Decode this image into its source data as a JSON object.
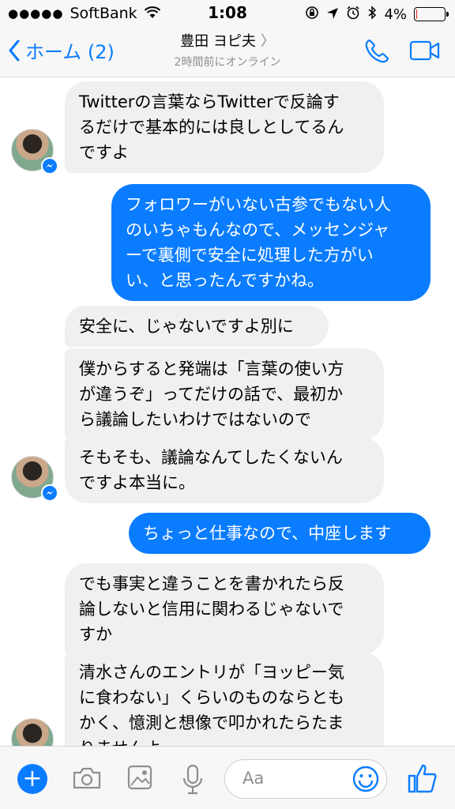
{
  "status_bar": {
    "signal": "●●●●●",
    "carrier": "SoftBank",
    "time": "1:08",
    "battery_percent_label": "4%",
    "battery_level": 0.04
  },
  "nav": {
    "back_label": "ホーム (2)",
    "title": "豊田 ヨピ夫",
    "subtitle": "2時間前にオンライン"
  },
  "messages": [
    {
      "direction": "in",
      "lines": [
        "Twitterの言葉ならTwitterで反論す",
        "るだけで基本的には良しとしてるん",
        "ですよ"
      ]
    },
    {
      "direction": "out",
      "lines": [
        "フォロワーがいない古参でもない人",
        "のいちゃもんなので、メッセンジャ",
        "ーで裏側で安全に処理した方がい",
        "い、と思ったんですかね。"
      ]
    },
    {
      "direction": "in",
      "lines": [
        "安全に、じゃないですよ別に"
      ]
    },
    {
      "direction": "in",
      "lines": [
        "僕からすると発端は「言葉の使い方",
        "が違うぞ」ってだけの話で、最初か",
        "ら議論したいわけではないので"
      ]
    },
    {
      "direction": "in",
      "lines": [
        "そもそも、議論なんてしたくないん",
        "ですよ本当に。"
      ]
    },
    {
      "direction": "out",
      "lines": [
        "ちょっと仕事なので、中座します"
      ]
    },
    {
      "direction": "in",
      "lines": [
        "でも事実と違うことを書かれたら反",
        "論しないと信用に関わるじゃないで",
        "すか"
      ]
    },
    {
      "direction": "in",
      "lines": [
        "清水さんのエントリが「ヨッピー気",
        "に食わない」くらいのものならとも",
        "かく、憶測と想像で叩かれたらたま",
        "りませんよ"
      ]
    }
  ],
  "composer": {
    "placeholder": "Aa"
  },
  "colors": {
    "accent": "#0a7cff",
    "incoming_bubble": "#f0f0f0",
    "bar_background": "#f7f7f7"
  },
  "icons": [
    "back-chevron-icon",
    "phone-icon",
    "video-camera-icon",
    "messenger-badge-icon",
    "plus-icon",
    "camera-icon",
    "gallery-icon",
    "microphone-icon",
    "emoji-icon",
    "thumbs-up-icon"
  ]
}
